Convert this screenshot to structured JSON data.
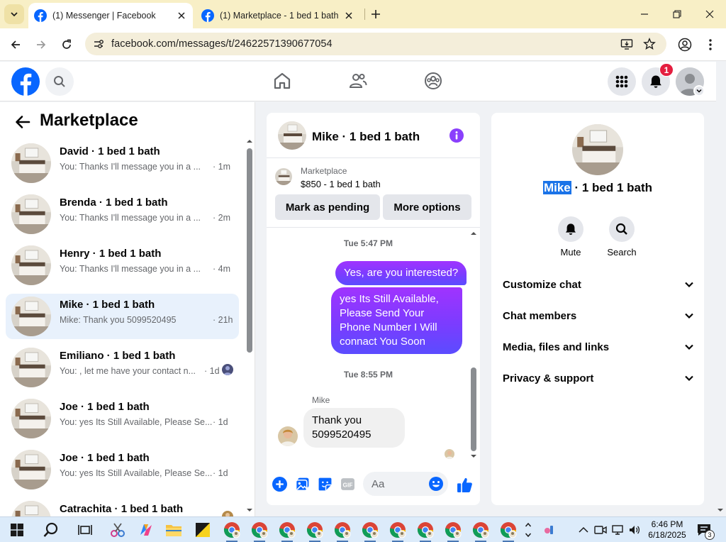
{
  "browser": {
    "tabs": [
      {
        "title": "(1) Messenger | Facebook",
        "active": true
      },
      {
        "title": "(1) Marketplace - 1 bed 1 bath",
        "active": false
      }
    ],
    "url": "facebook.com/messages/t/24622571390677054"
  },
  "fb_header": {
    "notification_count": "1",
    "colors": {
      "brand": "#0866ff",
      "badge": "#e41e3f"
    }
  },
  "left": {
    "title": "Marketplace",
    "conversations": [
      {
        "name": "David · 1 bed 1 bath",
        "preview": "You: Thanks I'll message you in a ...",
        "time": "· 1m",
        "selected": false
      },
      {
        "name": "Brenda · 1 bed 1 bath",
        "preview": "You: Thanks I'll message you in a ...",
        "time": "· 2m",
        "selected": false
      },
      {
        "name": "Henry · 1 bed 1 bath",
        "preview": "You: Thanks I'll message you in a ...",
        "time": "· 4m",
        "selected": false
      },
      {
        "name": "Mike · 1 bed 1 bath",
        "preview": "Mike: Thank you 5099520495",
        "time": "· 21h",
        "selected": true
      },
      {
        "name": "Emiliano · 1 bed 1 bath",
        "preview": "You: , let me have your contact n...",
        "time": "· 1d",
        "selected": false
      },
      {
        "name": "Joe · 1 bed 1 bath",
        "preview": "You: yes Its Still Available, Please Se...",
        "time": "· 1d",
        "selected": false
      },
      {
        "name": "Joe · 1 bed 1 bath",
        "preview": "You: yes Its Still Available, Please Se...",
        "time": "· 1d",
        "selected": false
      },
      {
        "name": "Catrachita · 1 bed 1 bath",
        "preview": "",
        "time": "",
        "selected": false
      }
    ]
  },
  "chat": {
    "title": "Mike · 1 bed 1 bath",
    "marketplace_label": "Marketplace",
    "listing": "$850 - 1 bed 1 bath",
    "mark_pending": "Mark as pending",
    "more_options": "More options",
    "timestamp1": "Tue 5:47 PM",
    "msg_out1": "Yes, are you interested?",
    "msg_out2": "yes Its Still Available, Please Send Your Phone Number I Will connact You Soon",
    "timestamp2": "Tue 8:55 PM",
    "sender": "Mike",
    "msg_in": "Thank you 5099520495",
    "composer_placeholder": "Aa",
    "colors": {
      "accent": "#8a3ffc",
      "bubble_in": "#f0f0f0"
    }
  },
  "info_panel": {
    "name_first": "Mike",
    "name_rest": " · 1 bed 1 bath",
    "mute": "Mute",
    "search": "Search",
    "sections": [
      "Customize chat",
      "Chat members",
      "Media, files and links",
      "Privacy & support"
    ]
  },
  "taskbar": {
    "time": "6:46 PM",
    "date": "6/18/2025",
    "notifications": "3"
  }
}
